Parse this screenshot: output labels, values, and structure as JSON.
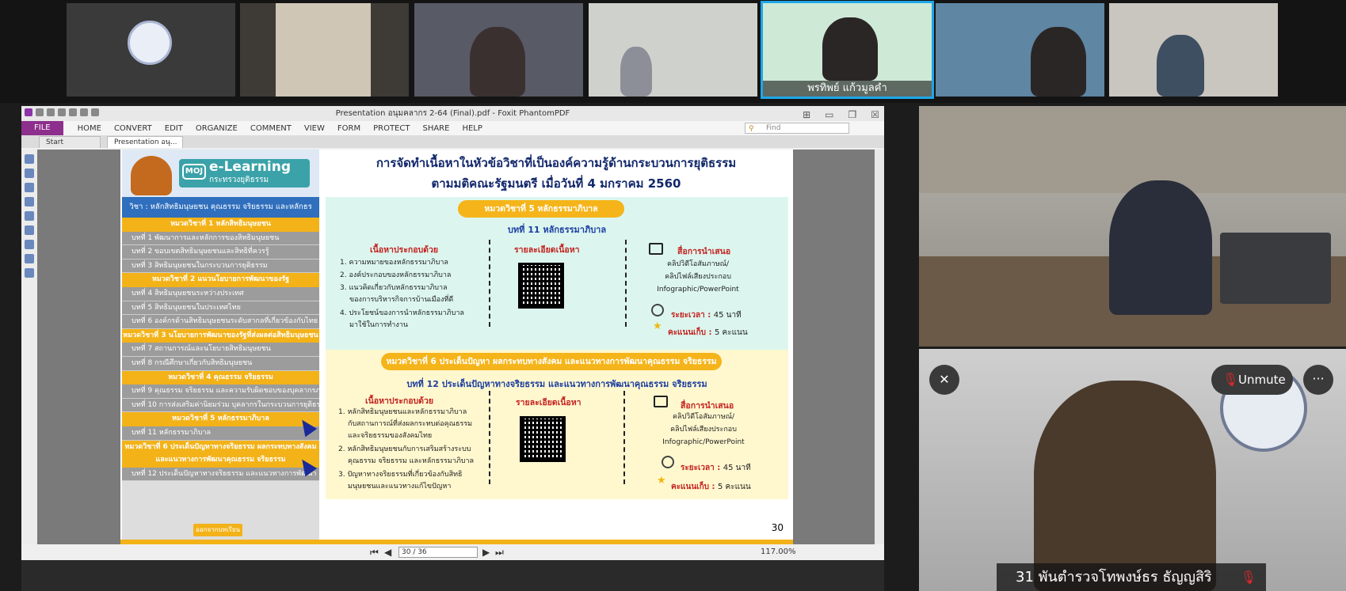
{
  "participants": [
    {
      "name": ""
    },
    {
      "name": ""
    },
    {
      "name": ""
    },
    {
      "name": ""
    },
    {
      "name": "พรทิพย์ แก้วมูลคำ",
      "active": true
    },
    {
      "name": ""
    },
    {
      "name": ""
    }
  ],
  "pdf": {
    "title": "Presentation อนุมคลากร 2-64 (Final).pdf - Foxit PhantomPDF",
    "menu": {
      "file": "FILE",
      "items": [
        "HOME",
        "CONVERT",
        "EDIT",
        "ORGANIZE",
        "COMMENT",
        "VIEW",
        "FORM",
        "PROTECT",
        "SHARE",
        "HELP"
      ]
    },
    "find_placeholder": "Find",
    "tabs": [
      "Start",
      "Presentation อนุ..."
    ],
    "tab_close": "×",
    "page_indicator": "30 / 36",
    "zoom": "117.00%"
  },
  "slide": {
    "brand": {
      "moj": "MOJ",
      "elearning": "e-Learning",
      "subtitle": "กระทรวงยุติธรรม"
    },
    "course": "วิชา : หลักสิทธิมนุษยชน คุณธรรม จริยธรรม และหลักธรรมาภิบาล",
    "toc": [
      {
        "type": "unit",
        "text": "หมวดวิชาที่ 1 หลักสิทธิมนุษยชน"
      },
      {
        "type": "lesson",
        "text": "บทที่ 1 พัฒนาการและหลักการของสิทธิมนุษยชน"
      },
      {
        "type": "lesson",
        "text": "บทที่ 2 ขอบเขตสิทธิมนุษยชนและสิทธิที่ควรรู้"
      },
      {
        "type": "lesson",
        "text": "บทที่ 3 สิทธิมนุษยชนในกระบวนการยุติธรรม"
      },
      {
        "type": "unit",
        "text": "หมวดวิชาที่ 2 แนวนโยบายการพัฒนาของรัฐ"
      },
      {
        "type": "lesson",
        "text": "บทที่ 4 สิทธิมนุษยชนระหว่างประเทศ"
      },
      {
        "type": "lesson",
        "text": "บทที่ 5 สิทธิมนุษยชนในประเทศไทย"
      },
      {
        "type": "lesson",
        "text": "บทที่ 6 องค์กรด้านสิทธิมนุษยชนระดับสากลที่เกี่ยวข้องกับไทย"
      },
      {
        "type": "unit",
        "text": "หมวดวิชาที่ 3 นโยบายการพัฒนาของรัฐที่ส่งผลต่อสิทธิมนุษยชน"
      },
      {
        "type": "lesson",
        "text": "บทที่ 7 สถานการณ์และนโยบายสิทธิมนุษยชน"
      },
      {
        "type": "lesson",
        "text": "บทที่ 8 กรณีศึกษาเกี่ยวกับสิทธิมนุษยชน"
      },
      {
        "type": "unit",
        "text": "หมวดวิชาที่ 4 คุณธรรม จริยธรรม"
      },
      {
        "type": "lesson",
        "text": "บทที่ 9 คุณธรรม จริยธรรม และความรับผิดชอบของบุคลากรภาครัฐ"
      },
      {
        "type": "lesson",
        "text": "บทที่ 10 การส่งเสริมค่านิยมร่วม บุคลากรในกระบวนการยุติธรรม"
      },
      {
        "type": "unit",
        "text": "หมวดวิชาที่ 5 หลักธรรมาภิบาล"
      },
      {
        "type": "lesson",
        "text": "บทที่ 11 หลักธรรมาภิบาล"
      },
      {
        "type": "unit2",
        "text": "หมวดวิชาที่ 6 ประเด็นปัญหาทางจริยธรรม ผลกระทบทางสังคม และแนวทางการพัฒนาคุณธรรม จริยธรรม"
      },
      {
        "type": "lesson",
        "text": "บทที่ 12 ประเด็นปัญหาทางจริยธรรม และแนวทางการพัฒนา"
      }
    ],
    "exit_label": "ออกจากบทเรียน",
    "title_line1": "การจัดทำเนื้อหาในหัวข้อวิชาที่เป็นองค์ความรู้ด้านกระบวนการยุติธรรม",
    "title_line2": "ตามมติคณะรัฐมนตรี เมื่อวันที่ 4 มกราคม 2560",
    "unit5": {
      "pill": "หมวดวิชาที่ 5 หลักธรรมาภิบาล",
      "lesson": "บทที่ 11 หลักธรรมาภิบาล",
      "content_head": "เนื้อหาประกอบด้วย",
      "items": [
        "1. ความหมายของหลักธรรมาภิบาล",
        "2. องค์ประกอบของหลักธรรมาภิบาล",
        "3. แนวคิดเกี่ยวกับหลักธรรมาภิบาล",
        "ของการบริหารกิจการบ้านเมืองที่ดี",
        "4. ประโยชน์ของการนำหลักธรรมาภิบาล",
        "มาใช้ในการทำงาน"
      ],
      "detail_head": "รายละเอียดเนื้อหา",
      "media_head": "สื่อการนำเสนอ",
      "media_lines": [
        "คลิปวิดีโอสัมภาษณ์/",
        "คลิปไฟล์เสียงประกอบ",
        "Infographic/PowerPoint"
      ],
      "duration_label": "ระยะเวลา :",
      "duration_value": "45 นาที",
      "score_label": "คะแนนเก็บ :",
      "score_value": "5 คะแนน"
    },
    "unit6": {
      "pill": "หมวดวิชาที่ 6 ประเด็นปัญหา ผลกระทบทางสังคม และแนวทางการพัฒนาคุณธรรม จริยธรรม",
      "lesson": "บทที่ 12 ประเด็นปัญหาทางจริยธรรม และแนวทางการพัฒนาคุณธรรม จริยธรรม",
      "content_head": "เนื้อหาประกอบด้วย",
      "items": [
        "1. หลักสิทธิมนุษยชนและหลักธรรมาภิบาล",
        "กับสถานการณ์ที่ส่งผลกระทบต่อคุณธรรม",
        "และจริยธรรมของสังคมไทย",
        "2. หลักสิทธิมนุษยชนกับการเสริมสร้างระบบ",
        "คุณธรรม จริยธรรม และหลักธรรมาภิบาล",
        "3. ปัญหาทางจริยธรรมที่เกี่ยวข้องกับสิทธิ",
        "มนุษยชนและแนวทางแก้ไขปัญหา"
      ],
      "detail_head": "รายละเอียดเนื้อหา",
      "media_head": "สื่อการนำเสนอ",
      "media_lines": [
        "คลิปวิดีโอสัมภาษณ์/",
        "คลิปไฟล์เสียงประกอบ",
        "Infographic/PowerPoint"
      ],
      "duration_label": "ระยะเวลา :",
      "duration_value": "45 นาที",
      "score_label": "คะแนนเก็บ :",
      "score_value": "5 คะแนน"
    },
    "page_number": "30"
  },
  "meeting": {
    "unmute_label": "Unmute",
    "more_label": "···",
    "speaker_name": "31 พันตำรวจโทพงษ์ธร ธัญญสิริ"
  },
  "colors": {
    "accent": "#f3b218",
    "title": "#12276b",
    "zoom_active": "#1fa6e8",
    "foxit_purple": "#8d2f8d"
  }
}
